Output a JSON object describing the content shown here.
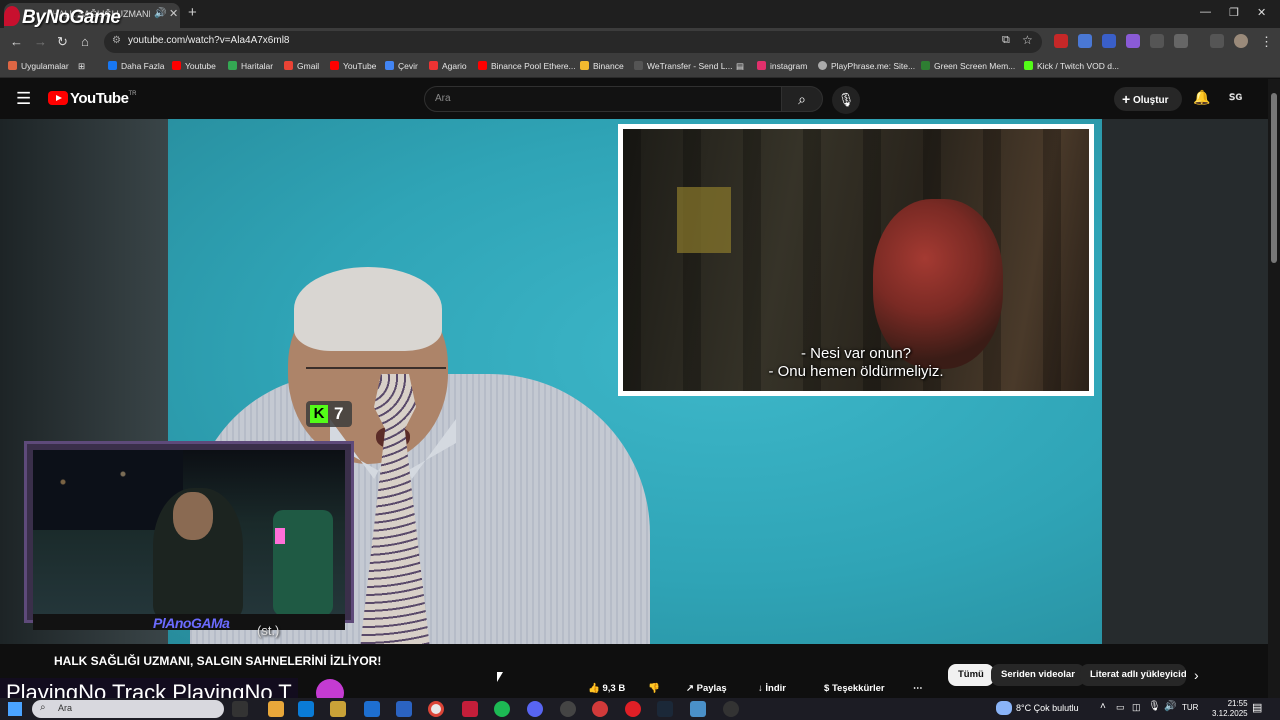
{
  "browser": {
    "tab_title": "HALK SAĞLIĞI UZMANI, SA",
    "new_tab": "+",
    "url": "youtube.com/watch?v=Ala4A7x6ml8",
    "watermark": "ByNoGame",
    "window_controls": [
      "—",
      "❐",
      "✕"
    ]
  },
  "bookmarks": [
    {
      "label": "Uygulamalar",
      "color": "#d64"
    },
    {
      "label": "Daha Fazla",
      "color": "#1877f2"
    },
    {
      "label": "Youtube",
      "color": "#ff0000"
    },
    {
      "label": "Haritalar",
      "color": "#34a853"
    },
    {
      "label": "Gmail",
      "color": "#ea4335"
    },
    {
      "label": "YouTube",
      "color": "#ff0000"
    },
    {
      "label": "Çevir",
      "color": "#4285f4"
    },
    {
      "label": "Agario",
      "color": "#e33"
    },
    {
      "label": "Binance Pool Ethere...",
      "color": "#ff0000"
    },
    {
      "label": "Binance",
      "color": "#f3ba2f"
    },
    {
      "label": "WeTransfer - Send L...",
      "color": "#555"
    },
    {
      "label": "instagram",
      "color": "#e1306c"
    },
    {
      "label": "PlayPhrase.me: Site...",
      "color": "#aaa"
    },
    {
      "label": "Green Screen Mem...",
      "color": "#2e7d32"
    },
    {
      "label": "Kick / Twitch VOD d...",
      "color": "#53fc18"
    }
  ],
  "youtube": {
    "logo_text": "YouTube",
    "logo_region": "TR",
    "search_placeholder": "Ara",
    "create_label": "Oluştur",
    "account_label": "ꜱɢ"
  },
  "video": {
    "subtitle_line1": "- Nesi var onun?",
    "subtitle_line2": "- Onu hemen öldürmeliyiz.",
    "kick_viewers": "7",
    "kick_letter": "K",
    "cam_name": "PlAnoGAMa",
    "bottom_caption": "(st.)"
  },
  "title": "HALK SAĞLIĞI UZMANI, SALGIN SAHNELERİNİ İZLİYOR!",
  "actions": {
    "likes": "9,3 B",
    "share": "Paylaş",
    "download": "İndir",
    "thanks": "Teşekkürler",
    "more": "⋯"
  },
  "chips": [
    "Tümü",
    "Seriden videolar",
    "Literat adlı yükleyiciden"
  ],
  "ticker_text": "PlayingNo Track PlayingNo T",
  "taskbar": {
    "search_text": "Ara",
    "weather": "8°C  Çok bulutlu",
    "lang": "TUR",
    "time": "21:55",
    "date": "3.12.2025"
  }
}
